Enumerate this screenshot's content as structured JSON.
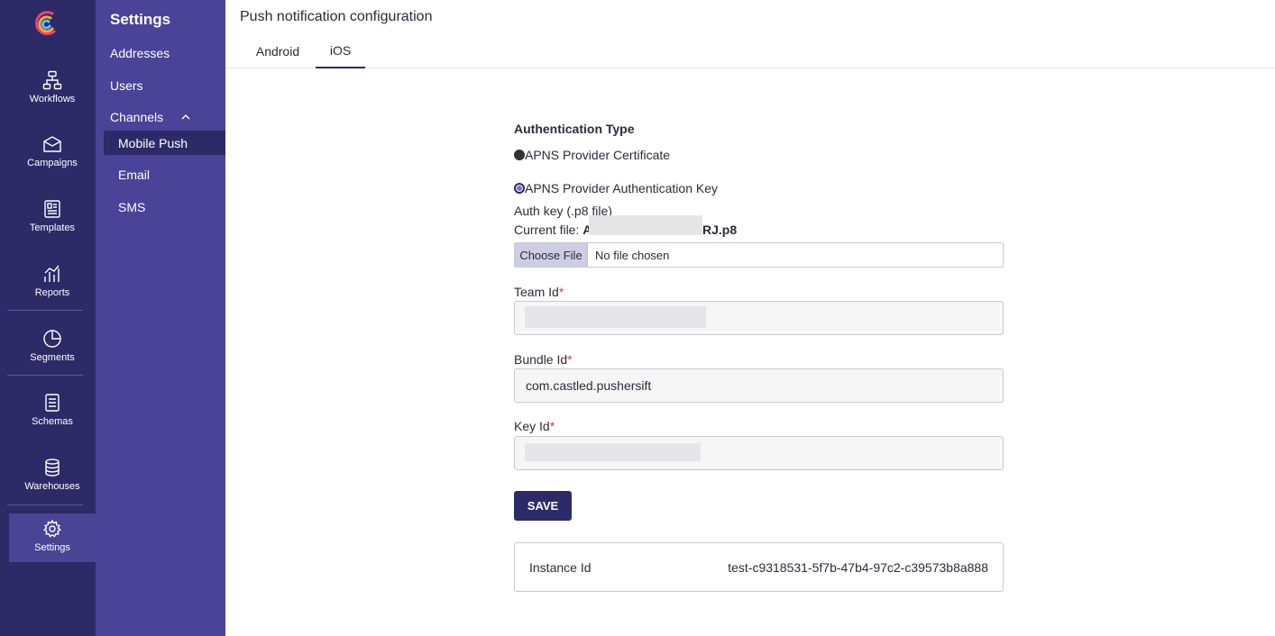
{
  "rail": {
    "items": [
      {
        "label": "Workflows",
        "icon": "workflow-icon"
      },
      {
        "label": "Campaigns",
        "icon": "campaign-icon"
      },
      {
        "label": "Templates",
        "icon": "template-icon"
      },
      {
        "label": "Reports",
        "icon": "chart-icon"
      },
      {
        "label": "Segments",
        "icon": "pie-icon"
      },
      {
        "label": "Schemas",
        "icon": "document-icon"
      },
      {
        "label": "Warehouses",
        "icon": "database-icon"
      },
      {
        "label": "Settings",
        "icon": "gear-icon"
      }
    ],
    "active": "Settings"
  },
  "sidebar": {
    "title": "Settings",
    "items": [
      "Addresses",
      "Users",
      "Channels"
    ],
    "channels": [
      "Mobile Push",
      "Email",
      "SMS"
    ],
    "active": "Mobile Push"
  },
  "header": {
    "title": "Push notification configuration",
    "tabs": [
      "Android",
      "iOS"
    ],
    "active_tab": "iOS"
  },
  "form": {
    "auth_type_label": "Authentication Type",
    "radio_cert": "APNS Provider Certificate",
    "radio_key": "APNS Provider Authentication Key",
    "selected": "APNS Provider Authentication Key",
    "auth_key_label": "Auth key (.p8 file)",
    "current_file_prefix": "Current file:",
    "current_file_visible": "A",
    "current_file_suffix": "RJ.p8",
    "choose_file": "Choose File",
    "no_file": "No file chosen",
    "team_id_label": "Team Id",
    "bundle_id_label": "Bundle Id",
    "bundle_id_value": "com.castled.pushersift",
    "key_id_label": "Key Id",
    "required_mark": "*",
    "save": "SAVE",
    "instance_label": "Instance Id",
    "instance_value": "test-c9318531-5f7b-47b4-97c2-c39573b8a888"
  },
  "colors": {
    "rail_bg": "#2d2a68",
    "sidebar_bg": "#4a4397",
    "accent": "#2d2a68",
    "required": "#d43a3a"
  }
}
